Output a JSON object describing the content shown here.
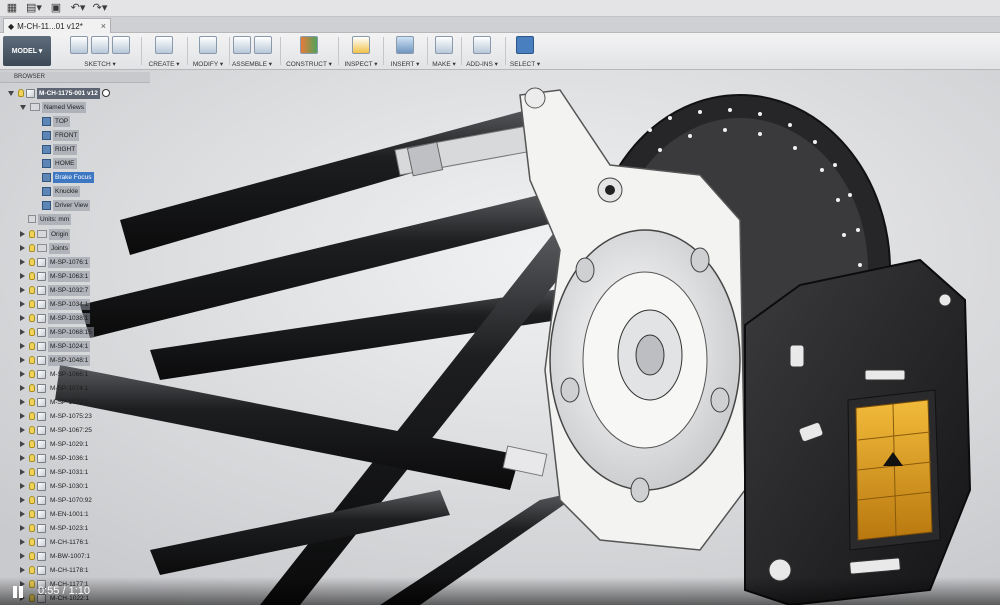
{
  "quick_access": {
    "icons": [
      "grid-icon",
      "file-icon",
      "save-icon",
      "undo-icon",
      "redo-icon"
    ]
  },
  "document_tab": {
    "title": "M-CH-11...01 v12*",
    "close": "×"
  },
  "toolbar": {
    "workspace": "MODEL ▾",
    "groups": [
      {
        "label": "SKETCH ▾"
      },
      {
        "label": "CREATE ▾"
      },
      {
        "label": "MODIFY ▾"
      },
      {
        "label": "ASSEMBLE ▾"
      },
      {
        "label": "CONSTRUCT ▾"
      },
      {
        "label": "INSPECT ▾"
      },
      {
        "label": "INSERT ▾"
      },
      {
        "label": "MAKE ▾"
      },
      {
        "label": "ADD-INS ▾"
      },
      {
        "label": "SELECT ▾"
      }
    ]
  },
  "browser": {
    "title": "BROWSER",
    "root": "M-CH-1175-001 v12",
    "named_views_label": "Named Views",
    "named_views": [
      "TOP",
      "FRONT",
      "RIGHT",
      "HOME",
      "Brake Focus",
      "Knuckle",
      "Driver View"
    ],
    "selected_view": "Brake Focus",
    "units": "Units: mm",
    "folders": [
      "Origin",
      "Joints"
    ],
    "components": [
      "M-SP-1076:1",
      "M-SP-1063:1",
      "M-SP-1032:7",
      "M-SP-1034:1",
      "M-SP-1038:1",
      "M-SP-1068:15",
      "M-SP-1024:1",
      "M-SP-1048:1",
      "M-SP-1066:1",
      "M-SP-1074:1",
      "M-SP-1022:1",
      "M-SP-1075:23",
      "M-SP-1067:25",
      "M-SP-1029:1",
      "M-SP-1036:1",
      "M-SP-1031:1",
      "M-SP-1030:1",
      "M-SP-1070:92",
      "M-EN-1001:1",
      "M-SP-1023:1",
      "M-CH-1176:1",
      "M-BW-1007:1",
      "M-CH-1178:1",
      "M-CH-1177:1",
      "M-CH-1022:1"
    ]
  },
  "video": {
    "time": "0:55 / 1:10"
  },
  "colors": {
    "selection": "#3e78c2",
    "caliper_pad": "#e3a21b",
    "tube": "#1c1c1e",
    "knuckle": "#f4f4f2",
    "rotor": "#2a2a2c"
  }
}
